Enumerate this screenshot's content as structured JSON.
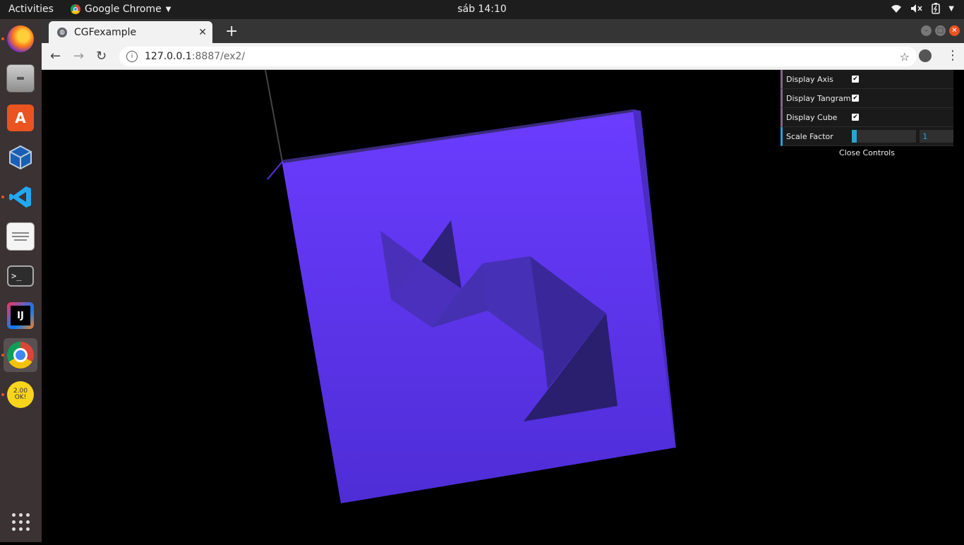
{
  "topbar": {
    "activities": "Activities",
    "app_name": "Google Chrome",
    "clock": "sáb 14:10",
    "tray_icons": [
      "wifi-icon",
      "volume-muted-icon",
      "battery-icon",
      "system-menu-icon"
    ]
  },
  "dock": {
    "items": [
      {
        "name": "firefox-icon",
        "running": true
      },
      {
        "name": "files-icon",
        "running": false
      },
      {
        "name": "software-center-icon",
        "running": false
      },
      {
        "name": "virtualbox-icon",
        "running": false
      },
      {
        "name": "vscode-icon",
        "running": true
      },
      {
        "name": "text-editor-icon",
        "running": false
      },
      {
        "name": "terminal-icon",
        "running": false
      },
      {
        "name": "intellij-icon",
        "running": false
      },
      {
        "name": "chrome-icon",
        "running": true
      },
      {
        "name": "sticker-icon",
        "running": true
      }
    ],
    "show_apps_icon": "grid-icon",
    "ij_label": "IJ",
    "terminal_label": ">_",
    "sticker_label": "2.00 OK!"
  },
  "browser": {
    "tab_title": "CGFexample",
    "tab_close": "✕",
    "new_tab": "+",
    "url_host": "127.0.0.1",
    "url_path": ":8887/ex2/",
    "back": "←",
    "forward": "→",
    "reload": "↻",
    "star": "☆",
    "menu": "⋮"
  },
  "gui": {
    "controls": [
      {
        "label": "Display Axis",
        "checked": true
      },
      {
        "label": "Display Tangram",
        "checked": true
      },
      {
        "label": "Display Cube",
        "checked": true
      }
    ],
    "scale": {
      "label": "Scale Factor",
      "value": "1",
      "fraction": 0.08
    },
    "close_label": "Close Controls",
    "check_mark": "✔"
  },
  "colors": {
    "cube_face": "#6a3cff",
    "cube_face_bottom": "#4f2ed8",
    "tangram_dark": "#2a1e6e",
    "gui_folder_accent": "#806787",
    "gui_number_accent": "#2fa1d6"
  }
}
